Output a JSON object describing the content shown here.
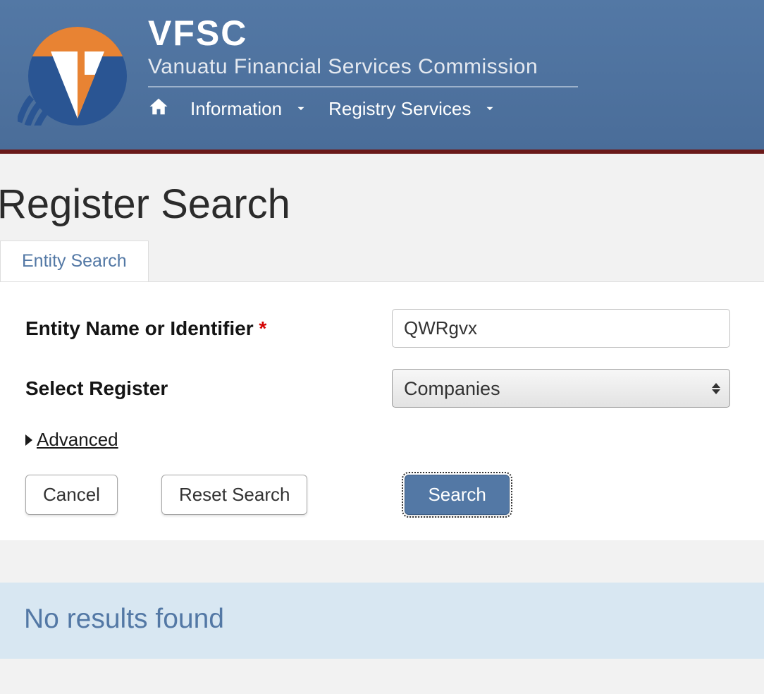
{
  "header": {
    "brand": "VFSC",
    "tagline": "Vanuatu Financial Services Commission"
  },
  "nav": {
    "information": "Information",
    "registry_services": "Registry Services"
  },
  "page": {
    "title": "Register Search"
  },
  "tabs": {
    "entity_search": "Entity Search"
  },
  "form": {
    "entity_label": "Entity Name or Identifier",
    "entity_value": "QWRgvx",
    "register_label": "Select Register",
    "register_value": "Companies",
    "advanced_label": "Advanced",
    "required_mark": "*"
  },
  "buttons": {
    "cancel": "Cancel",
    "reset": "Reset Search",
    "search": "Search"
  },
  "results": {
    "none": "No results found"
  }
}
